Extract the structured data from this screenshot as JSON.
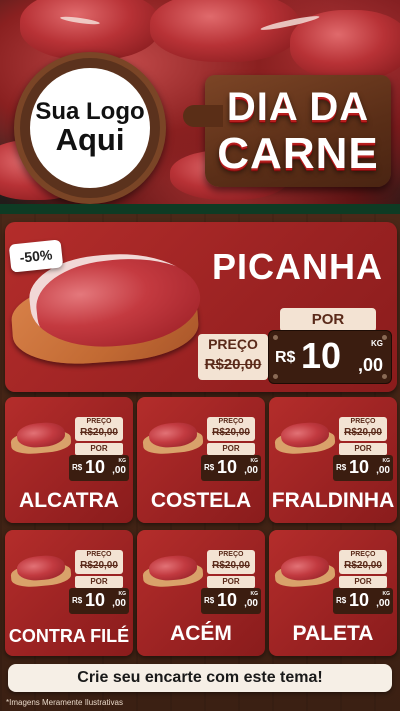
{
  "header": {
    "logo_line1": "Sua Logo",
    "logo_line2": "Aqui",
    "title_line1": "DIA DA",
    "title_line2": "CARNE"
  },
  "featured": {
    "discount": "-50%",
    "name": "PICANHA",
    "preco_label": "PREÇO",
    "old_price": "R$20,00",
    "por_label": "POR",
    "currency": "R$",
    "price_int": "10",
    "price_dec": ",00",
    "unit": "KG"
  },
  "products": [
    {
      "name": "ALCATRA",
      "preco_label": "PREÇO",
      "old_price": "R$20,00",
      "por_label": "POR",
      "currency": "R$",
      "price_int": "10",
      "price_dec": ",00",
      "unit": "KG"
    },
    {
      "name": "COSTELA",
      "preco_label": "PREÇO",
      "old_price": "R$20,00",
      "por_label": "POR",
      "currency": "R$",
      "price_int": "10",
      "price_dec": ",00",
      "unit": "KG"
    },
    {
      "name": "FRALDINHA",
      "preco_label": "PREÇO",
      "old_price": "R$20,00",
      "por_label": "POR",
      "currency": "R$",
      "price_int": "10",
      "price_dec": ",00",
      "unit": "KG"
    },
    {
      "name": "CONTRA FILÉ",
      "preco_label": "PREÇO",
      "old_price": "R$20,00",
      "por_label": "POR",
      "currency": "R$",
      "price_int": "10",
      "price_dec": ",00",
      "unit": "KG"
    },
    {
      "name": "ACÉM",
      "preco_label": "PREÇO",
      "old_price": "R$20,00",
      "por_label": "POR",
      "currency": "R$",
      "price_int": "10",
      "price_dec": ",00",
      "unit": "KG"
    },
    {
      "name": "PALETA",
      "preco_label": "PREÇO",
      "old_price": "R$20,00",
      "por_label": "POR",
      "currency": "R$",
      "price_int": "10",
      "price_dec": ",00",
      "unit": "KG"
    }
  ],
  "footer": {
    "cta": "Crie seu encarte com este tema!",
    "disclaimer": "*Imagens Meramente Ilustrativas"
  },
  "colors": {
    "card_red": "#b42d2b",
    "wood_brown": "#4b2818",
    "price_box": "#3b1d10",
    "label_cream": "#f3e3d3",
    "stripe_green": "#0e3b24"
  }
}
